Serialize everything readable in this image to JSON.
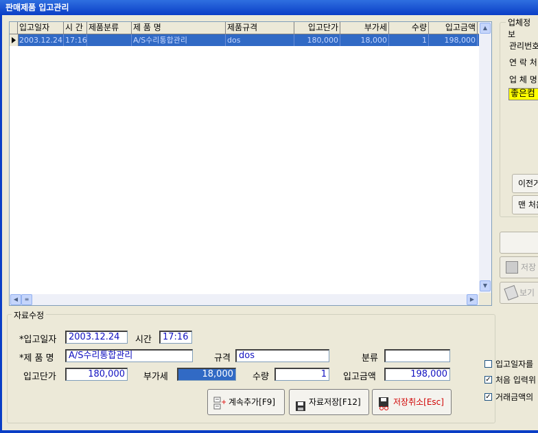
{
  "window": {
    "title": "판매제품 입고관리"
  },
  "grid": {
    "columns": [
      "입고일자",
      "시 간",
      "제품분류",
      "제 품 명",
      "제품규격",
      "입고단가",
      "부가세",
      "수량",
      "입고금액"
    ],
    "rows": [
      {
        "date": "2003.12.24",
        "time": "17:16",
        "category": "",
        "name": "A/S수리통합관리",
        "spec": "dos",
        "unit_price": "180,000",
        "vat": "18,000",
        "qty": "1",
        "amount": "198,000"
      }
    ]
  },
  "right_panel": {
    "group_title": "업체정보",
    "label_mgmt": "관리번호",
    "label_contact": "연 락 처",
    "label_company": "업 체 명",
    "company_value": "좋은컴",
    "btn_prev": "이전거래",
    "btn_first": "맨 처음",
    "btn_save": "저장",
    "btn_print": "보기"
  },
  "edit": {
    "group_title": "자료수정",
    "label_date": "*입고일자",
    "date": "2003.12.24",
    "label_time": "시간",
    "time": "17:16",
    "label_name": "*제 품 명",
    "name": "A/S수리통합관리",
    "label_spec": "규격",
    "spec": "dos",
    "label_category": "분류",
    "category": "",
    "label_unit_price": "입고단가",
    "unit_price": "180,000",
    "label_vat": "부가세",
    "vat": "18,000",
    "label_qty": "수량",
    "qty": "1",
    "label_amount": "입고금액",
    "amount": "198,000"
  },
  "buttons": {
    "continue": "계속추가[F9]",
    "save": "자료저장[F12]",
    "cancel": "저장취소[Esc]"
  },
  "options": {
    "opt1": "입고일자를",
    "opt1_checked": false,
    "opt2": "처음 입력위",
    "opt2_checked": true,
    "opt3": "거래금액의",
    "opt3_checked": true
  },
  "colors": {
    "title_bar": "#0a3ec6",
    "selection": "#316ac5",
    "highlight": "#ffff00",
    "cancel_text": "#d00000"
  }
}
